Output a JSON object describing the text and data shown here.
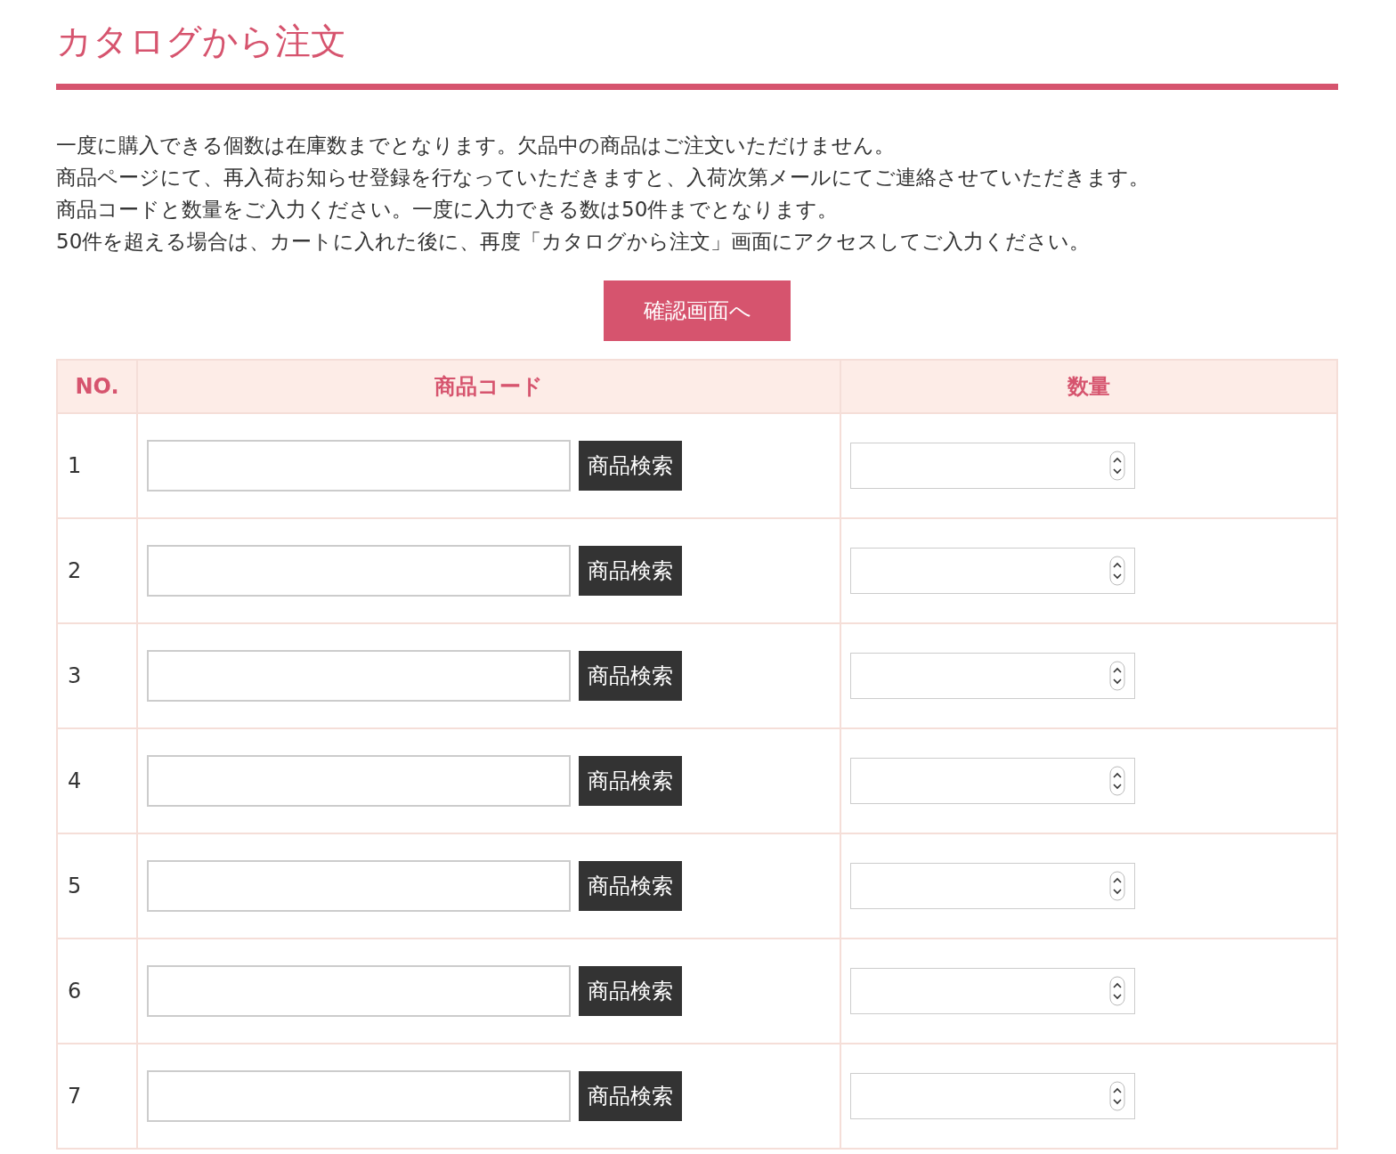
{
  "title": "カタログから注文",
  "notes": [
    "一度に購入できる個数は在庫数までとなります。欠品中の商品はご注文いただけません。",
    "商品ページにて、再入荷お知らせ登録を行なっていただきますと、入荷次第メールにてご連絡させていただきます。",
    "商品コードと数量をご入力ください。一度に入力できる数は50件までとなります。",
    "50件を超える場合は、カートに入れた後に、再度「カタログから注文」画面にアクセスしてご入力ください。"
  ],
  "confirm_button": "確認画面へ",
  "table": {
    "columns": [
      "NO.",
      "商品コード",
      "数量"
    ],
    "rows": [
      {
        "no": "1",
        "search_button": "商品検索"
      },
      {
        "no": "2",
        "search_button": "商品検索"
      },
      {
        "no": "3",
        "search_button": "商品検索"
      },
      {
        "no": "4",
        "search_button": "商品検索"
      },
      {
        "no": "5",
        "search_button": "商品検索"
      },
      {
        "no": "6",
        "search_button": "商品検索"
      },
      {
        "no": "7",
        "search_button": "商品検索"
      }
    ]
  }
}
